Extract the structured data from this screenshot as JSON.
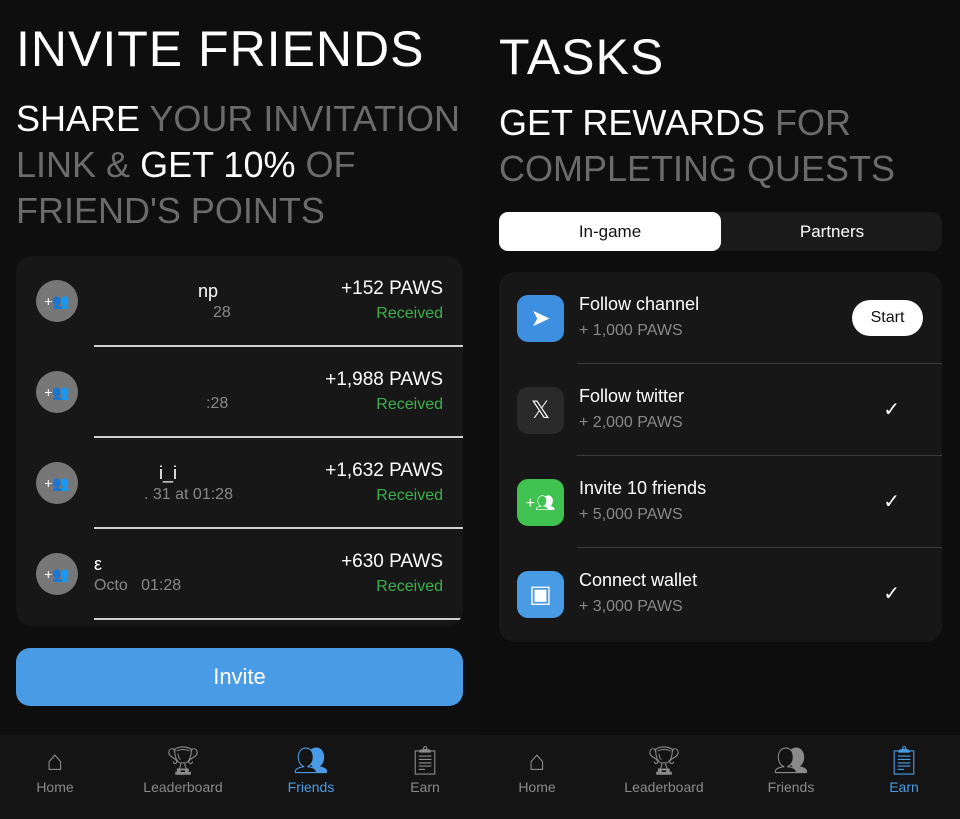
{
  "friends_screen": {
    "title": "INVITE FRIENDS",
    "subtitle": {
      "p1": "SHARE",
      "p2": " YOUR INVITATION LINK & ",
      "p3": "GET 10%",
      "p4": " OF FRIEND'S POINTS"
    },
    "friends": [
      {
        "name": "np",
        "date": "28",
        "amount": "+152 PAWS",
        "status": "Received"
      },
      {
        "name": "",
        "date": ":28",
        "amount": "+1,988 PAWS",
        "status": "Received"
      },
      {
        "name": "i_i",
        "date": ". 31 at 01:28",
        "amount": "+1,632 PAWS",
        "status": "Received"
      },
      {
        "name": "ε",
        "date": "Octo   01:28",
        "amount": "+630 PAWS",
        "status": "Received"
      }
    ],
    "invite_label": "Invite",
    "nav": [
      {
        "label": "Home",
        "icon": "home-icon"
      },
      {
        "label": "Leaderboard",
        "icon": "trophy-icon"
      },
      {
        "label": "Friends",
        "icon": "friends-icon",
        "active": true
      },
      {
        "label": "Earn",
        "icon": "clipboard-icon"
      }
    ]
  },
  "tasks_screen": {
    "title": "TASKS",
    "subtitle": {
      "p1": "GET REWARDS",
      "p2": " FOR COMPLETING QUESTS"
    },
    "tabs": [
      "In-game",
      "Partners"
    ],
    "tasks": [
      {
        "name": "Follow channel",
        "reward": "+ 1,000 PAWS",
        "icon": "telegram-icon",
        "color": "#3d8fe0",
        "action": "Start"
      },
      {
        "name": "Follow twitter",
        "reward": "+ 2,000 PAWS",
        "icon": "x-icon",
        "color": "#2a2a2a",
        "action": "✓"
      },
      {
        "name": "Invite 10 friends",
        "reward": "+ 5,000 PAWS",
        "icon": "add-friends-icon",
        "color": "#3fc24f",
        "action": "✓"
      },
      {
        "name": "Connect wallet",
        "reward": "+ 3,000 PAWS",
        "icon": "wallet-icon",
        "color": "#4a9be6",
        "action": "✓"
      }
    ],
    "nav": [
      {
        "label": "Home",
        "icon": "home-icon"
      },
      {
        "label": "Leaderboard",
        "icon": "trophy-icon"
      },
      {
        "label": "Friends",
        "icon": "friends-icon"
      },
      {
        "label": "Earn",
        "icon": "clipboard-icon",
        "active": true
      }
    ]
  },
  "colors": {
    "accent": "#4a9be6",
    "received": "#3cb04d"
  }
}
